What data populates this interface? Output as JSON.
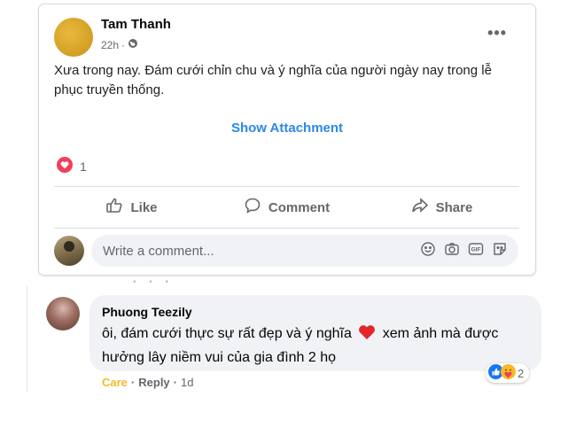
{
  "post": {
    "author": "Tam Thanh",
    "time": "22h",
    "meta_sep": "·",
    "more": "•••",
    "text": "Xưa trong nay. Đám cưới chỉn chu và ý nghĩa của người ngày nay trong lễ phục truyền thống.",
    "show_attachment": "Show Attachment",
    "reaction_count": "1",
    "actions": {
      "like": "Like",
      "comment": "Comment",
      "share": "Share"
    },
    "comment_placeholder": "Write a comment..."
  },
  "comment": {
    "author": "Phuong Teezily",
    "text_part1": "ôi, đám cưới thực sự rất đẹp và ý nghĩa",
    "text_part2": "xem ảnh mà được hưởng lây niềm vui của gia đình 2 họ",
    "reaction_count": "2",
    "care_label": "Care",
    "reply_label": "Reply",
    "sep": "·",
    "time": "1d"
  },
  "icons": [
    "globe-icon",
    "more-icon",
    "heart-reaction-icon",
    "like-icon",
    "comment-icon",
    "share-icon",
    "emoji-icon",
    "camera-icon",
    "gif-icon",
    "sticker-icon",
    "heart-emoji-icon",
    "care-reaction-icon"
  ],
  "colors": {
    "link_blue": "#2d88e8",
    "heart_red": "#f33e58",
    "care_yellow": "#f7b928",
    "muted": "#65676b",
    "input_bg": "#f0f2f5"
  }
}
